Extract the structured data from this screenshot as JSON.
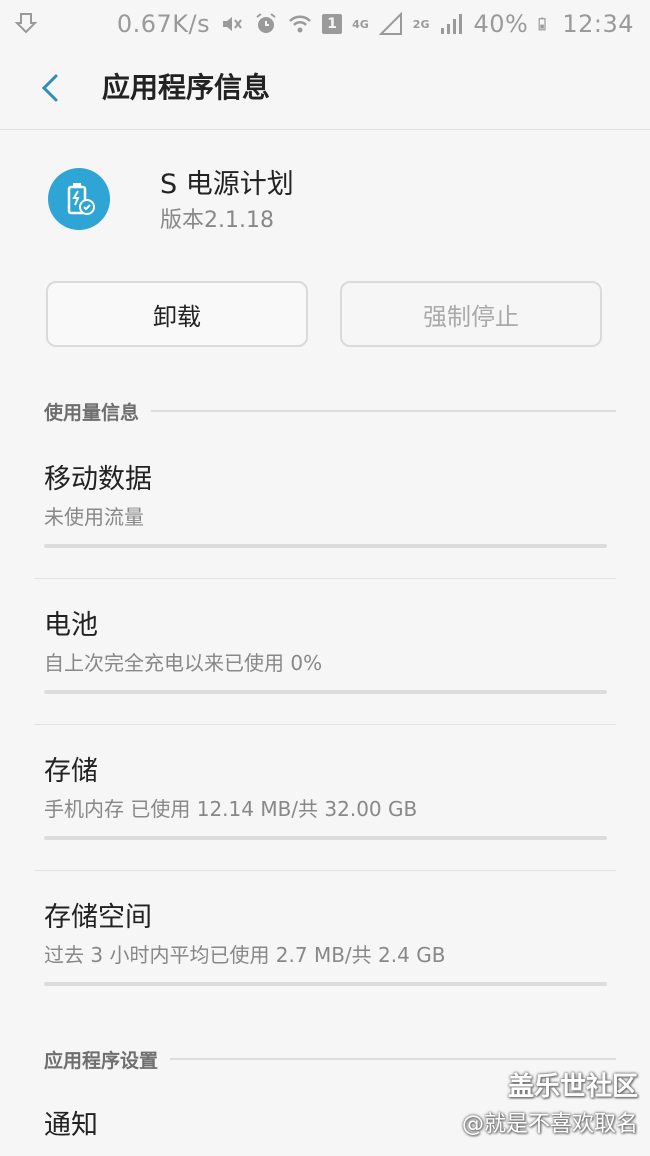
{
  "status_bar": {
    "speed": "0.67K/s",
    "sim_badge": "1",
    "network_4g": "4G",
    "network_2g": "2G",
    "battery": "40%",
    "time": "12:34"
  },
  "header": {
    "title": "应用程序信息"
  },
  "app": {
    "name": "S 电源计划",
    "version": "版本2.1.18",
    "icon_color": "#2ea5d4"
  },
  "buttons": {
    "uninstall": "卸载",
    "force_stop": "强制停止"
  },
  "sections": {
    "usage": "使用量信息",
    "settings": "应用程序设置"
  },
  "items": [
    {
      "title": "移动数据",
      "subtitle": "未使用流量"
    },
    {
      "title": "电池",
      "subtitle": "自上次完全充电以来已使用 0%"
    },
    {
      "title": "存储",
      "subtitle": "手机内存 已使用 12.14 MB/共 32.00 GB"
    },
    {
      "title": "存储空间",
      "subtitle": "过去 3 小时内平均已使用 2.7 MB/共 2.4 GB"
    }
  ],
  "notification": {
    "title": "通知"
  },
  "watermark": {
    "line1": "盖乐世社区",
    "line2": "@就是不喜欢取名"
  }
}
